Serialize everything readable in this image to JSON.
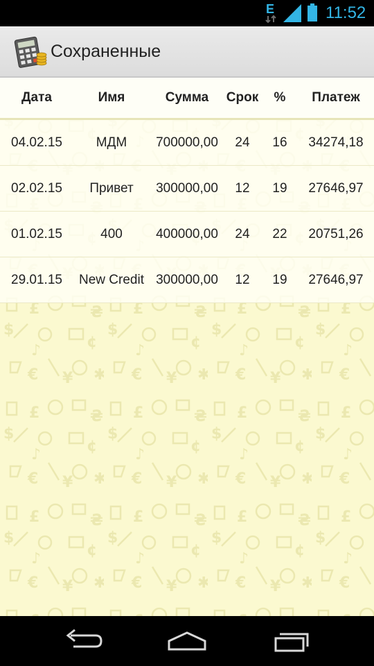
{
  "status_bar": {
    "network_type": "E",
    "time": "11:52",
    "icons": [
      "data-activity-icon",
      "signal-icon",
      "battery-icon"
    ]
  },
  "action_bar": {
    "icon": "calculator-app-icon",
    "title": "Сохраненные"
  },
  "table": {
    "headers": {
      "date": "Дата",
      "name": "Имя",
      "sum": "Сумма",
      "term": "Срок",
      "percent": "%",
      "payment": "Платеж"
    },
    "rows": [
      {
        "date": "04.02.15",
        "name": "МДМ",
        "sum": "700000,00",
        "term": "24",
        "percent": "16",
        "payment": "34274,18"
      },
      {
        "date": "02.02.15",
        "name": "Привет",
        "sum": "300000,00",
        "term": "12",
        "percent": "19",
        "payment": "27646,97"
      },
      {
        "date": "01.02.15",
        "name": "400",
        "sum": "400000,00",
        "term": "24",
        "percent": "22",
        "payment": "20751,26"
      },
      {
        "date": "29.01.15",
        "name": "New Credit",
        "sum": "300000,00",
        "term": "12",
        "percent": "19",
        "payment": "27646,97"
      }
    ]
  },
  "nav_bar": {
    "buttons": [
      "back-icon",
      "home-icon",
      "recent-apps-icon"
    ]
  },
  "colors": {
    "accent": "#33b5e5",
    "background": "#fbf9d0",
    "pattern": "#efecb8"
  }
}
